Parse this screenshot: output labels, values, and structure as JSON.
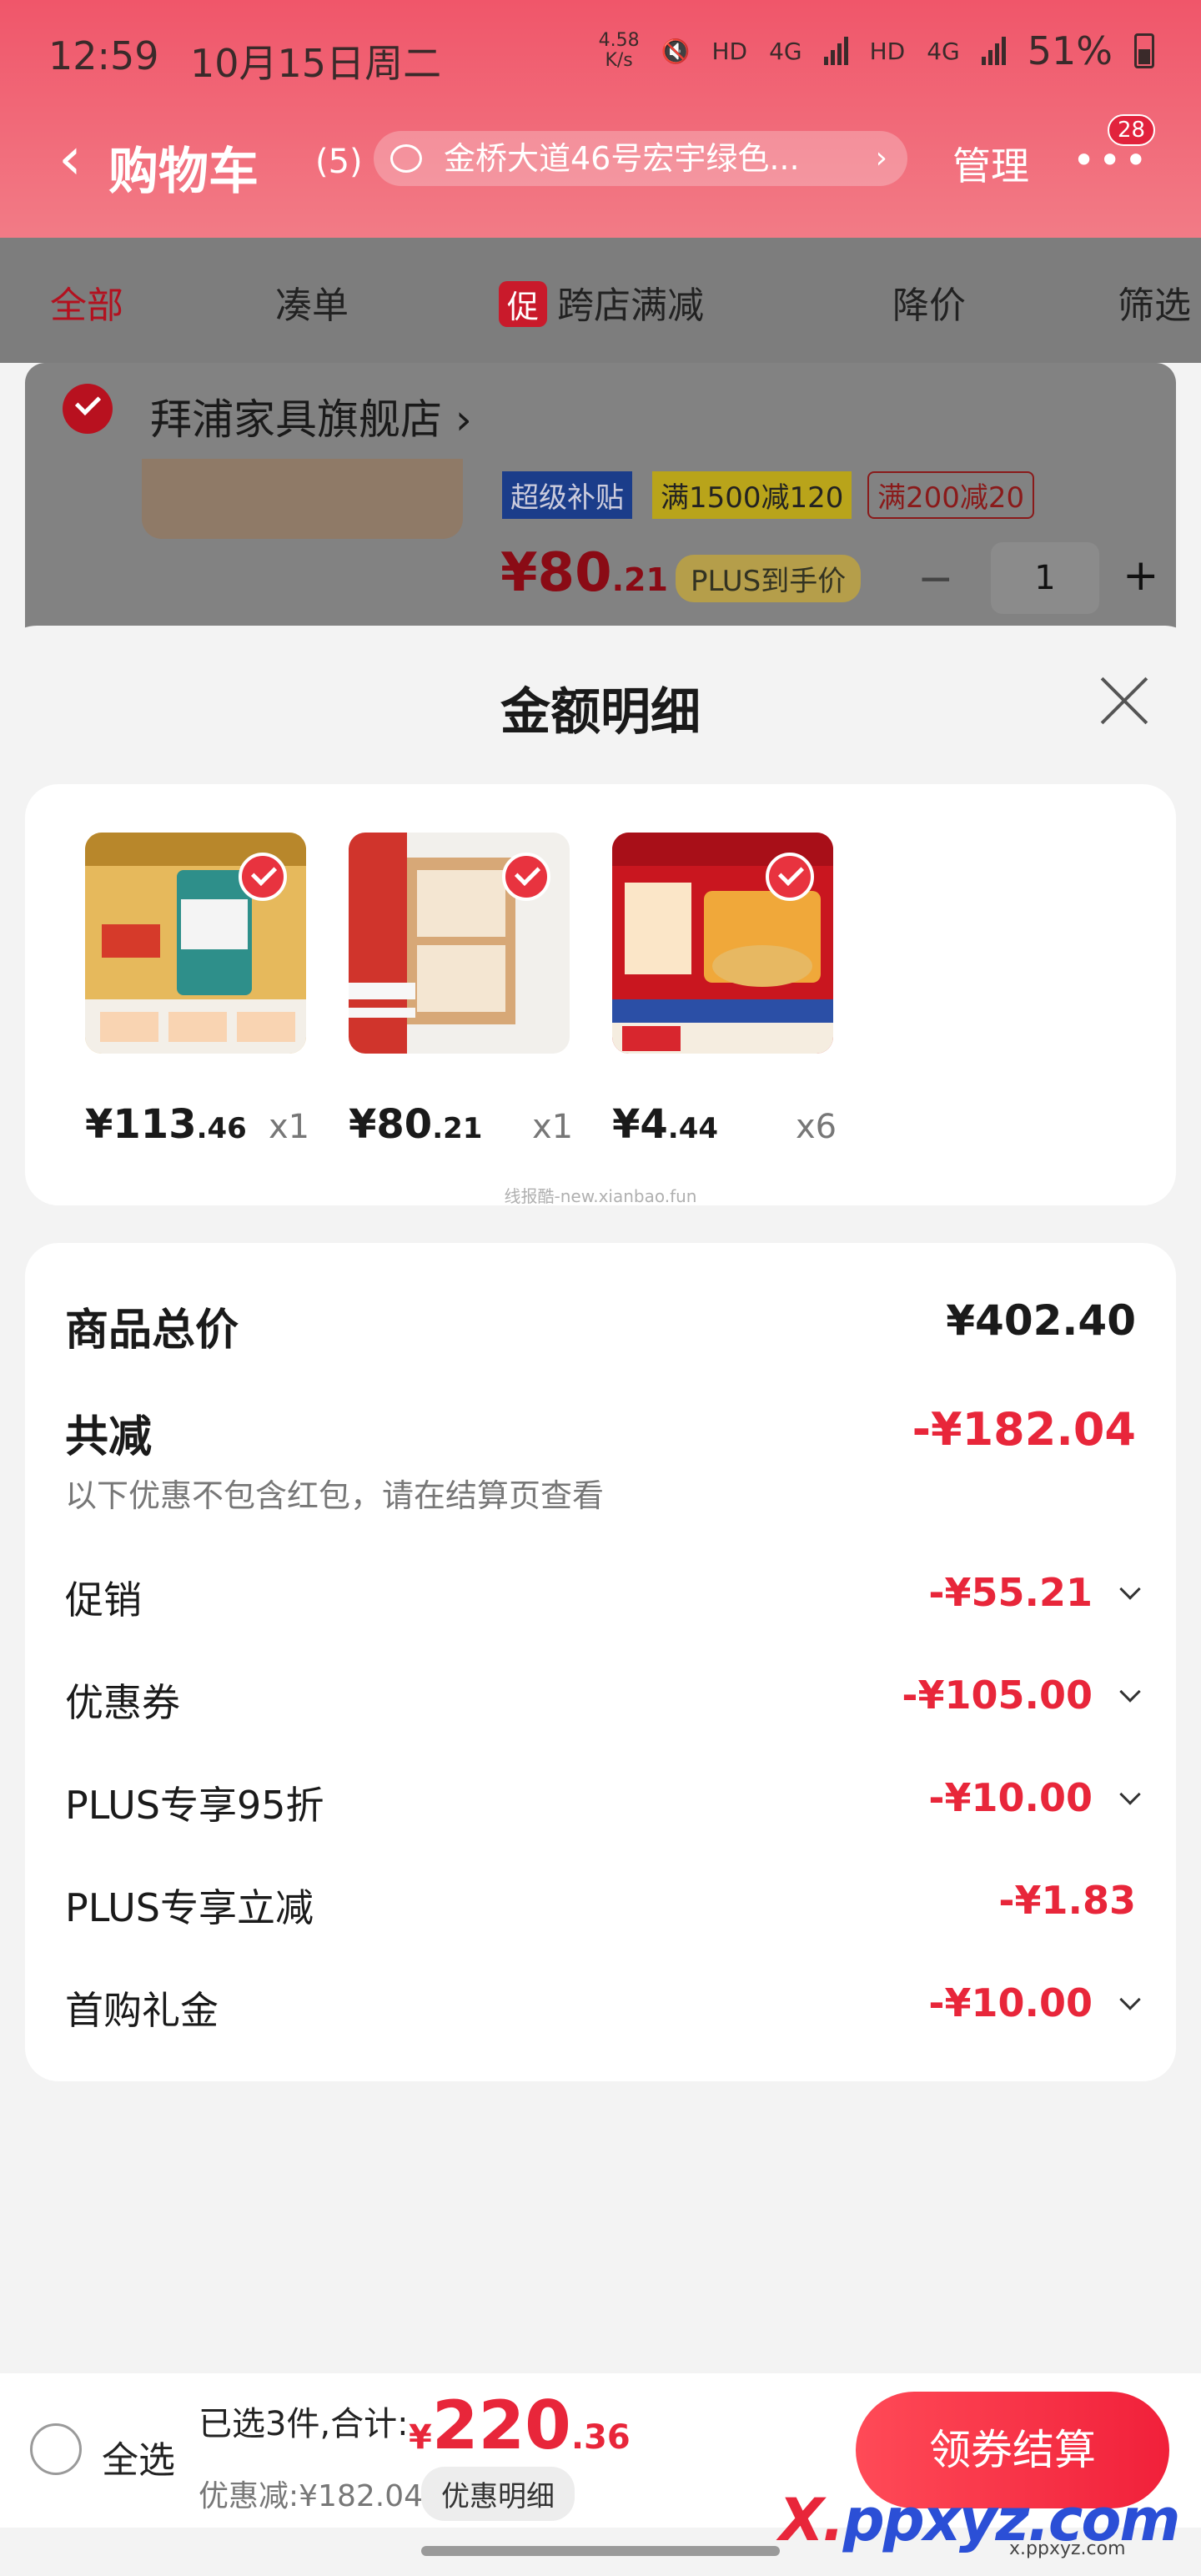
{
  "status_bar": {
    "time": "12:59",
    "date": "10月15日周二",
    "speed": "4.58\nK/s",
    "hd1": "HD",
    "net1": "4G",
    "hd2": "HD",
    "net2": "4G",
    "battery": "51%"
  },
  "nav": {
    "title": "购物车",
    "count": "(5)",
    "address": "金桥大道46号宏宇绿色...",
    "manage": "管理",
    "more": "•••",
    "badge": "28"
  },
  "tabs": [
    {
      "label": "全部"
    },
    {
      "label": "凑单"
    },
    {
      "badge": "促",
      "label": "跨店满减"
    },
    {
      "label": "降价"
    },
    {
      "label": "筛选"
    }
  ],
  "shop": {
    "name": "拜浦家具旗舰店",
    "tag1": "超级补贴",
    "tag2": "满1500减120",
    "tag3": "满200减20",
    "price_int": "¥80",
    "price_dec": ".21",
    "plus_label": "PLUS到手价",
    "quantity": "1"
  },
  "sheet": {
    "title": "金额明细",
    "watermark": "线报酷-new.xianbao.fun",
    "products": [
      {
        "price_int": "¥113",
        "price_dec": ".46",
        "qty": "x1",
        "accent": "#c9a13a"
      },
      {
        "price_int": "¥80",
        "price_dec": ".21",
        "qty": "x1",
        "accent": "#d9b48a"
      },
      {
        "price_int": "¥4",
        "price_dec": ".44",
        "qty": "x6",
        "accent": "#d8262e"
      }
    ],
    "summary": {
      "total_label": "商品总价",
      "total_value": "¥402.40",
      "reduce_label": "共减",
      "reduce_value": "-¥182.04",
      "reduce_note": "以下优惠不包含红包，请在结算页查看",
      "items": [
        {
          "label": "促销",
          "value": "-¥55.21"
        },
        {
          "label": "优惠券",
          "value": "-¥105.00"
        },
        {
          "label": "PLUS专享95折",
          "value": "-¥10.00"
        },
        {
          "label": "PLUS专享立减",
          "value": "-¥1.83"
        },
        {
          "label": "首购礼金",
          "value": "-¥10.00"
        }
      ]
    }
  },
  "bottom": {
    "select_all": "全选",
    "selected_text": "已选3件,合计:",
    "total_currency": "¥",
    "total_int": "220",
    "total_dec": ".36",
    "discount_text": "优惠减:¥182.04",
    "detail_button": "优惠明细",
    "checkout_button": "领券结算"
  },
  "watermark_logo": {
    "mark": "ppxyz.com",
    "x": "X.",
    "sub": "x.ppxyz.com"
  },
  "colors": {
    "accent_red": "#e8263a",
    "header_gradient_top": "#f0566a"
  }
}
